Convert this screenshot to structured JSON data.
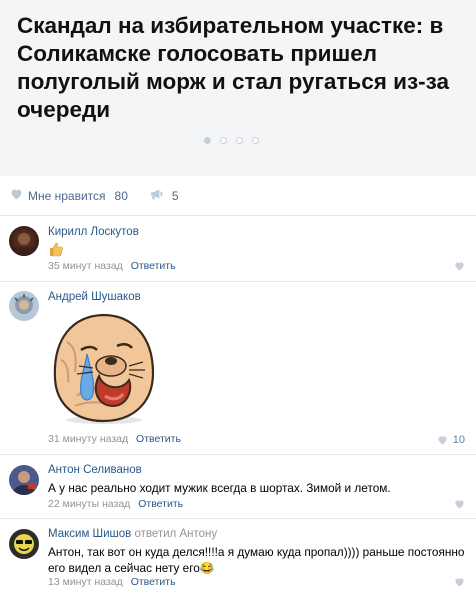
{
  "post": {
    "title": "Скандал на избирательном участке: в Соликамске голосовать пришел полуголый морж и стал ругаться из-за очереди",
    "carousel_dots": 4,
    "carousel_active": 0
  },
  "likes_bar": {
    "like_label": "Мне нравится",
    "like_count": "80",
    "share_count": "5",
    "heart_icon": "heart-icon",
    "share_icon": "megaphone-icon"
  },
  "comments": [
    {
      "author": "Кирилл Лоскутов",
      "text": "",
      "sticker": "thumbs-up-emoji",
      "time": "35 минут назад",
      "reply": "Ответить",
      "likes": ""
    },
    {
      "author": "Андрей Шушаков",
      "text": "",
      "sticker": "crying-seal-sticker",
      "time": "31 минуту назад",
      "reply": "Ответить",
      "likes": "10"
    },
    {
      "author": "Антон Селиванов",
      "text": "А у нас реально ходит мужик всегда в шортах. Зимой и летом.",
      "time": "22 минуты назад",
      "reply": "Ответить",
      "likes": ""
    },
    {
      "author": "Максим Шишов",
      "reply_to": "ответил Антону",
      "text": "Антон, так вот он куда делся!!!!а я думаю куда пропал)))) раньше постоянно его видел а сейчас нету его😂",
      "time": "13 минут назад",
      "reply": "Ответить",
      "likes": ""
    }
  ],
  "colors": {
    "link": "#2a5885",
    "muted": "#939393",
    "icon": "#bccad9",
    "card_bg": "#f4f5f7"
  }
}
